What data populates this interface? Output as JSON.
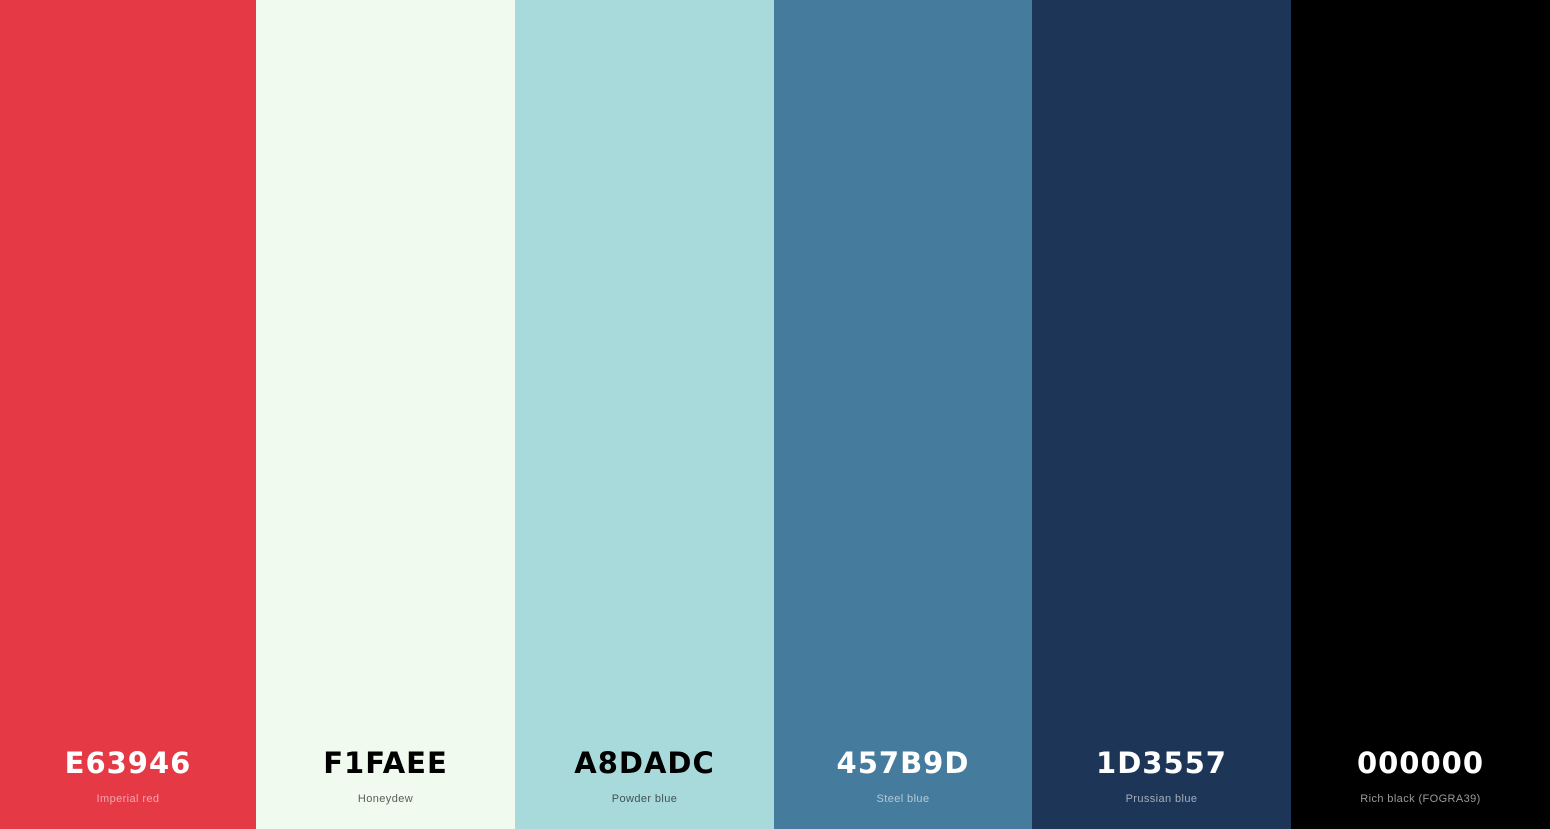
{
  "palette": {
    "colors": [
      {
        "hex": "E63946",
        "name": "Imperial red",
        "bg": "#E63946",
        "text_color": "#FFFFFF",
        "name_color": "#F2A6AC"
      },
      {
        "hex": "F1FAEE",
        "name": "Honeydew",
        "bg": "#F1FAEE",
        "text_color": "#000000",
        "name_color": "#5A5E59"
      },
      {
        "hex": "A8DADC",
        "name": "Powder blue",
        "bg": "#A8DADC",
        "text_color": "#000000",
        "name_color": "#3F5253"
      },
      {
        "hex": "457B9D",
        "name": "Steel blue",
        "bg": "#457B9D",
        "text_color": "#FFFFFF",
        "name_color": "#B5CAD8"
      },
      {
        "hex": "1D3557",
        "name": "Prussian blue",
        "bg": "#1D3557",
        "text_color": "#FFFFFF",
        "name_color": "#A5AEBC"
      },
      {
        "hex": "000000",
        "name": "Rich black (FOGRA39)",
        "bg": "#000000",
        "text_color": "#FFFFFF",
        "name_color": "#9A9A9A"
      }
    ]
  }
}
